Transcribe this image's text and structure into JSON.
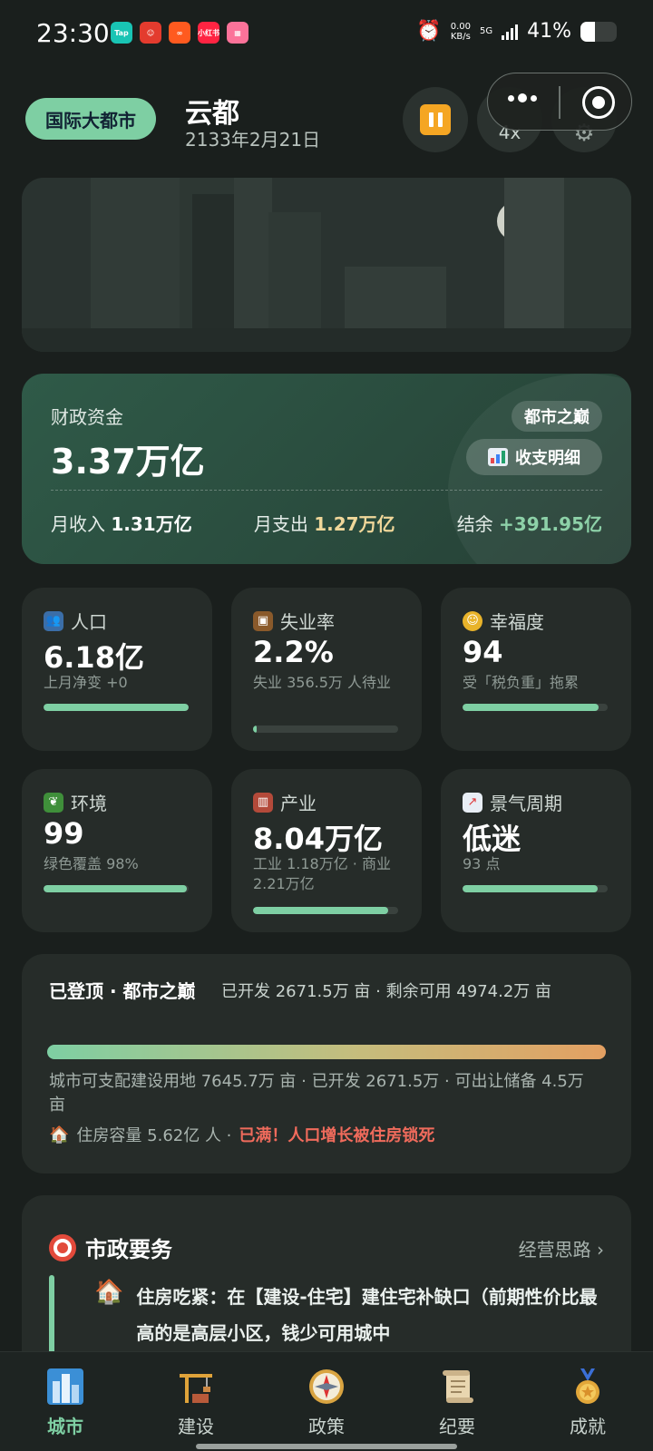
{
  "status_bar": {
    "time": "23:30",
    "net_speed_value": "0.00",
    "net_speed_unit": "KB/s",
    "network": "5G",
    "battery": "41%",
    "battery_level": 0.41,
    "apps": [
      {
        "name": "Tap",
        "color": "#19c4b4"
      },
      {
        "name": "",
        "color": "#e33b2e"
      },
      {
        "name": "",
        "color": "#ff5a1f"
      },
      {
        "name": "小红书",
        "color": "#ff2442"
      },
      {
        "name": "",
        "color": "#fb7299"
      }
    ]
  },
  "header": {
    "rank_badge": "国际大都市",
    "city_name": "云都",
    "date": "2133年2月21日",
    "speed": "4x",
    "accent_color": "#7ecfa3"
  },
  "finance": {
    "label": "财政资金",
    "value": "3.37万亿",
    "tag": "都市之巅",
    "detail_button": "收支明细",
    "income_label": "月收入",
    "income_value": "1.31万亿",
    "expense_label": "月支出",
    "expense_value": "1.27万亿",
    "balance_label": "结余",
    "balance_value": "+391.95亿"
  },
  "stats": [
    {
      "title": "人口",
      "icon": "people-icon",
      "value": "6.18亿",
      "sub": "上月净变 +0",
      "level": 1.0
    },
    {
      "title": "失业率",
      "icon": "briefcase-icon",
      "value": "2.2%",
      "sub": "失业 356.5万 人待业",
      "level": 0.022
    },
    {
      "title": "幸福度",
      "icon": "smile-icon",
      "value": "94",
      "sub": "受「税负重」拖累",
      "level": 0.94
    },
    {
      "title": "环境",
      "icon": "leaf-icon",
      "value": "99",
      "sub": "绿色覆盖 98%",
      "level": 0.99
    },
    {
      "title": "产业",
      "icon": "factory-icon",
      "value": "8.04万亿",
      "sub": "工业 1.18万亿 · 商业 2.21万亿",
      "level": 0.93
    },
    {
      "title": "景气周期",
      "icon": "trend-chart-icon",
      "value": "低迷",
      "sub": "93 点",
      "level": 0.93
    }
  ],
  "land": {
    "title": "已登顶 · 都市之巅",
    "developed_text": "已开发 2671.5万 亩 · 剩余可用 4974.2万 亩",
    "capacity_text": "城市可支配建设用地 7645.7万 亩 · 已开发 2671.5万 · 可出让储备 4.5万 亩",
    "housing_text": "住房容量 5.62亿 人 ·",
    "housing_warning": "已满！人口增长被住房锁死"
  },
  "affairs": {
    "title": "市政要务",
    "link": "经营思路 ›",
    "item_text": "住房吃紧：在【建设-住宅】建住宅补缺口（前期性价比最高的是高层小区，钱少可用城中"
  },
  "nav": [
    {
      "label": "城市",
      "icon": "city-icon",
      "active": true
    },
    {
      "label": "建设",
      "icon": "construction-crane-icon",
      "active": false
    },
    {
      "label": "政策",
      "icon": "compass-icon",
      "active": false
    },
    {
      "label": "纪要",
      "icon": "scroll-icon",
      "active": false
    },
    {
      "label": "成就",
      "icon": "medal-icon",
      "active": false
    }
  ]
}
